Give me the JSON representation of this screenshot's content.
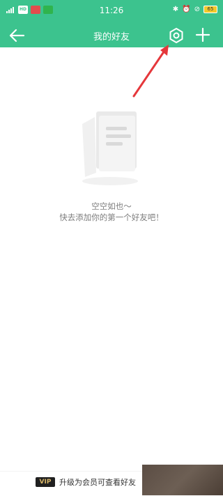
{
  "status_bar": {
    "time": "11:26",
    "left_icons": [
      "signal-icon",
      "hd-icon",
      "app-icon-red",
      "app-icon-green"
    ],
    "right_icons": [
      "bluetooth-icon",
      "alarm-icon",
      "mute-icon"
    ],
    "battery": "65"
  },
  "header": {
    "title": "我的好友",
    "back_icon": "arrow-left-icon",
    "settings_icon": "settings-icon",
    "add_icon": "plus-icon"
  },
  "empty_state": {
    "line1": "空空如也～",
    "line2": "快去添加你的第一个好友吧！"
  },
  "vip_bar": {
    "badge": "VIP",
    "text": "升级为会员可查看好友"
  },
  "colors": {
    "primary": "#3cc38e",
    "annotation_arrow": "#e5373b"
  }
}
